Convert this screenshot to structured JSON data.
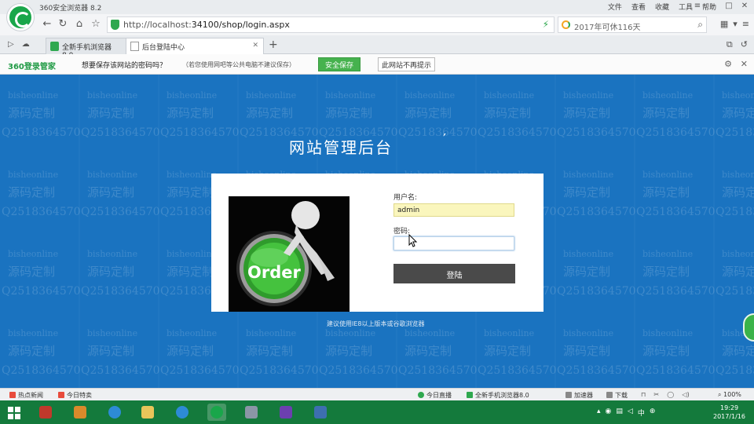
{
  "browser": {
    "title": "360安全浏览器 8.2",
    "menu": [
      "文件",
      "查看",
      "收藏",
      "工具",
      "帮助"
    ],
    "url_host": "http://localhost:",
    "url_path": "34100/shop/login.aspx",
    "search_text": "2017年可休116天",
    "tabs": [
      {
        "label": "全新手机浏览器8.0",
        "active": false
      },
      {
        "label": "后台登陆中心",
        "active": true
      }
    ]
  },
  "password_bar": {
    "brand": "360登录管家",
    "question": "想要保存该网站的密码吗？",
    "note": "（若您使用网吧等公共电脑不建议保存）",
    "save_button": "安全保存",
    "never_button": "此网站不再提示"
  },
  "page": {
    "title": "网站管理后台",
    "title_mark": "′",
    "image_text": "Order",
    "username_label": "用户名:",
    "username_value": "admin",
    "password_label": "密码:",
    "password_value": "",
    "login_button": "登陆",
    "hint": "建议使用IE8以上版本或谷歌浏览器",
    "watermark_lines": [
      "bisheonline",
      "源码定制",
      "Q2518364570"
    ]
  },
  "statusbar": {
    "left": [
      "热点新闻",
      "今日特卖"
    ],
    "right": [
      "今日直播",
      "全新手机浏览器8.0",
      "加速器",
      "下载",
      "100%"
    ]
  },
  "clock": {
    "time": "19:29",
    "date": "2017/1/16"
  },
  "colors": {
    "page_bg": "#1a73c0",
    "taskbar": "#147a3c",
    "save_button": "#46b24e",
    "username_bg": "#faf6bd",
    "login_button": "#4a4a4a"
  }
}
